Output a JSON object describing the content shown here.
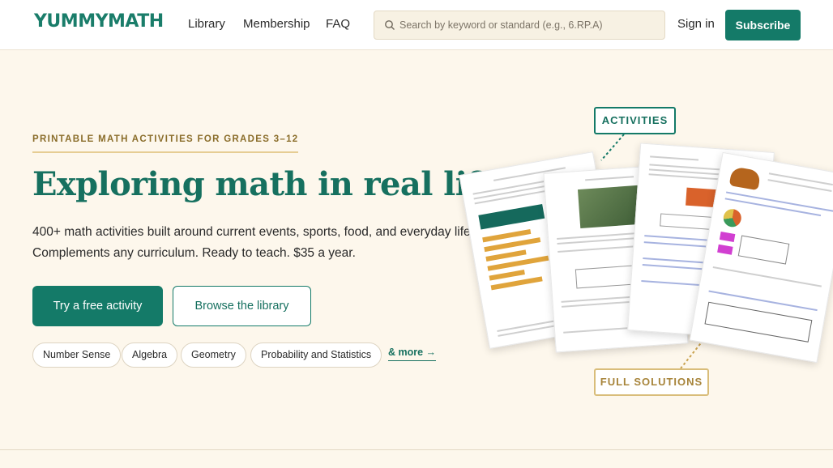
{
  "header": {
    "logo": "YUMMYMATH",
    "nav": [
      "Library",
      "Membership",
      "FAQ"
    ],
    "search_placeholder": "Search by keyword or standard (e.g., 6.RP.A)",
    "signin": "Sign in",
    "subscribe": "Subscribe"
  },
  "hero": {
    "eyebrow": "PRINTABLE MATH ACTIVITIES FOR GRADES 3–12",
    "headline": "Exploring math in real life.",
    "subtext_line1": "400+ math activities built around current events, sports, food, and everyday life.",
    "subtext_line2": "Complements any curriculum. Ready to teach. $35 a year.",
    "primary_button": "Try a free activity",
    "secondary_button": "Browse the library",
    "topics": [
      "Number Sense",
      "Algebra",
      "Geometry",
      "Probability and Statistics"
    ],
    "more_link": "& more →"
  },
  "labels": {
    "activities": "ACTIVITIES",
    "solutions": "FULL SOLUTIONS"
  },
  "colors": {
    "brand": "#147a68",
    "accent_gold": "#d9bd7a",
    "background": "#fdf7ec"
  }
}
